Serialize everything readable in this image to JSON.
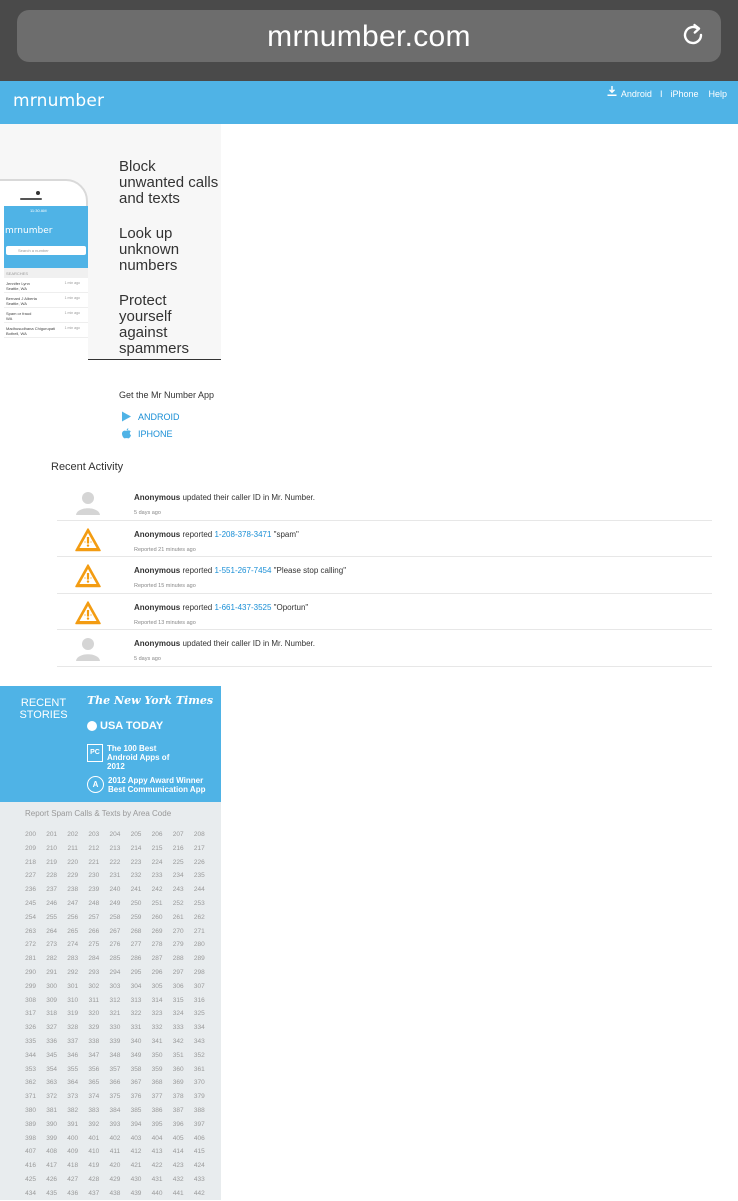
{
  "browser": {
    "url": "mrnumber.com"
  },
  "header": {
    "logo": "mrnumber",
    "links": [
      "Android",
      "I",
      "iPhone",
      "Help"
    ]
  },
  "hero": {
    "taglines": [
      "Block unwanted calls and texts",
      "Look up unknown numbers",
      "Protect yourself against spammers"
    ],
    "phone_logo": "mrnumber",
    "phone_search_placeholder": "Search a number",
    "phone_section": "SEARCHES",
    "phone_rows": [
      {
        "name": "Jennifer Lynn",
        "place": "Seattle, WA",
        "time": "1 min ago"
      },
      {
        "name": "Bernard J Alberta",
        "place": "Seattle, WA",
        "time": "1 min ago"
      },
      {
        "name": "Spam or fraud",
        "place": "WA",
        "time": "1 min ago"
      },
      {
        "name": "Madhusudhana Chigurupati",
        "place": "Bothell, WA",
        "time": "1 min ago"
      }
    ],
    "phone_status": "11:30 AM"
  },
  "get_app": {
    "title": "Get the Mr Number App",
    "android": "ANDROID",
    "iphone": "IPHONE"
  },
  "recent_activity": {
    "title": "Recent Activity",
    "items": [
      {
        "type": "update",
        "who": "Anonymous",
        "text": "updated their caller ID in Mr. Number.",
        "number": "",
        "quote": "",
        "time": "5 days ago"
      },
      {
        "type": "report",
        "who": "Anonymous",
        "text": "reported",
        "number": "1-208-378-3471",
        "quote": "\"spam\"",
        "time": "Reported 21 minutes ago"
      },
      {
        "type": "report",
        "who": "Anonymous",
        "text": "reported",
        "number": "1-551-267-7454",
        "quote": "\"Please stop calling\"",
        "time": "Reported 15 minutes ago"
      },
      {
        "type": "report",
        "who": "Anonymous",
        "text": "reported",
        "number": "1-661-437-3525",
        "quote": "\"Oportun\"",
        "time": "Reported 13 minutes ago"
      },
      {
        "type": "update",
        "who": "Anonymous",
        "text": "updated their caller ID in Mr. Number.",
        "number": "",
        "quote": "",
        "time": "5 days ago"
      }
    ]
  },
  "stories": {
    "title": "RECENT STORIES",
    "nyt": "The New York Times",
    "usatoday": "USA TODAY",
    "pcmag_box": "PC",
    "pcmag": "The 100 Best Android Apps of 2012",
    "appy_badge": "A",
    "appy": "2012 Appy Award Winner Best Communication App"
  },
  "area_codes": {
    "title": "Report Spam Calls & Texts by Area Code",
    "start": 200,
    "end": 442
  },
  "colors": {
    "brand": "#4fb3e6",
    "link": "#1a8fd6",
    "warning": "#f39c12"
  }
}
